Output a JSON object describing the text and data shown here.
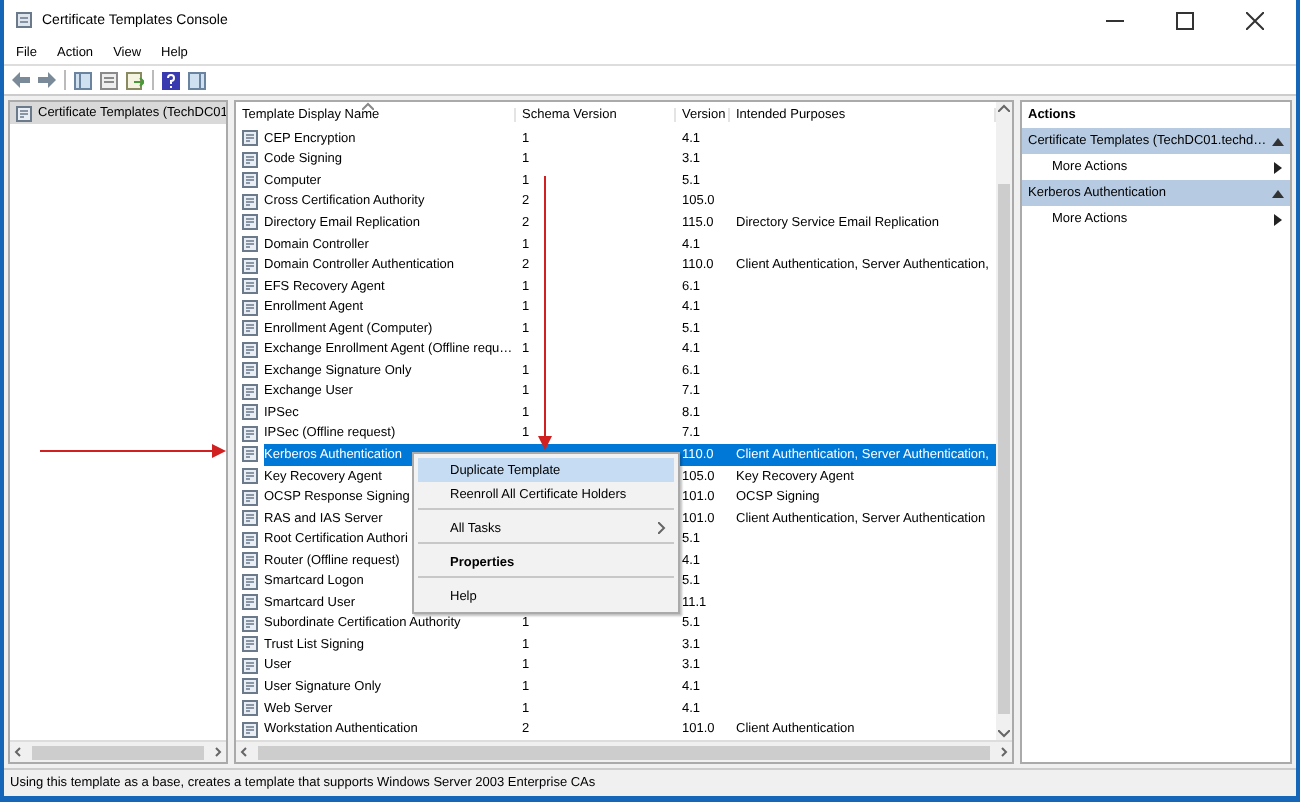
{
  "window": {
    "title": "Certificate Templates Console"
  },
  "menu_bar": [
    "File",
    "Action",
    "View",
    "Help"
  ],
  "tree": {
    "items": [
      {
        "label": "Certificate Templates (TechDC01",
        "selected": true
      }
    ]
  },
  "list": {
    "columns": [
      "Template Display Name",
      "Schema Version",
      "Version",
      "Intended Purposes"
    ],
    "rows": [
      {
        "name": "CEP Encryption",
        "schema": "1",
        "version": "4.1",
        "purposes": "",
        "selected": false
      },
      {
        "name": "Code Signing",
        "schema": "1",
        "version": "3.1",
        "purposes": "",
        "selected": false
      },
      {
        "name": "Computer",
        "schema": "1",
        "version": "5.1",
        "purposes": "",
        "selected": false
      },
      {
        "name": "Cross Certification Authority",
        "schema": "2",
        "version": "105.0",
        "purposes": "",
        "selected": false
      },
      {
        "name": "Directory Email Replication",
        "schema": "2",
        "version": "115.0",
        "purposes": "Directory Service Email Replication",
        "selected": false
      },
      {
        "name": "Domain Controller",
        "schema": "1",
        "version": "4.1",
        "purposes": "",
        "selected": false
      },
      {
        "name": "Domain Controller Authentication",
        "schema": "2",
        "version": "110.0",
        "purposes": "Client Authentication, Server Authentication,",
        "selected": false
      },
      {
        "name": "EFS Recovery Agent",
        "schema": "1",
        "version": "6.1",
        "purposes": "",
        "selected": false
      },
      {
        "name": "Enrollment Agent",
        "schema": "1",
        "version": "4.1",
        "purposes": "",
        "selected": false
      },
      {
        "name": "Enrollment Agent (Computer)",
        "schema": "1",
        "version": "5.1",
        "purposes": "",
        "selected": false
      },
      {
        "name": "Exchange Enrollment Agent (Offline requ…",
        "schema": "1",
        "version": "4.1",
        "purposes": "",
        "selected": false
      },
      {
        "name": "Exchange Signature Only",
        "schema": "1",
        "version": "6.1",
        "purposes": "",
        "selected": false
      },
      {
        "name": "Exchange User",
        "schema": "1",
        "version": "7.1",
        "purposes": "",
        "selected": false
      },
      {
        "name": "IPSec",
        "schema": "1",
        "version": "8.1",
        "purposes": "",
        "selected": false
      },
      {
        "name": "IPSec (Offline request)",
        "schema": "1",
        "version": "7.1",
        "purposes": "",
        "selected": false
      },
      {
        "name": "Kerberos Authentication",
        "schema": "",
        "version": "110.0",
        "purposes": "Client Authentication, Server Authentication,",
        "selected": true
      },
      {
        "name": "Key Recovery Agent",
        "schema": "",
        "version": "105.0",
        "purposes": "Key Recovery Agent",
        "selected": false
      },
      {
        "name": "OCSP Response Signing",
        "schema": "",
        "version": "101.0",
        "purposes": "OCSP Signing",
        "selected": false
      },
      {
        "name": "RAS and IAS Server",
        "schema": "",
        "version": "101.0",
        "purposes": "Client Authentication, Server Authentication",
        "selected": false
      },
      {
        "name": "Root Certification Authori",
        "schema": "",
        "version": "5.1",
        "purposes": "",
        "selected": false
      },
      {
        "name": "Router (Offline request)",
        "schema": "",
        "version": "4.1",
        "purposes": "",
        "selected": false
      },
      {
        "name": "Smartcard Logon",
        "schema": "",
        "version": "5.1",
        "purposes": "",
        "selected": false
      },
      {
        "name": "Smartcard User",
        "schema": "",
        "version": "11.1",
        "purposes": "",
        "selected": false
      },
      {
        "name": "Subordinate Certification Authority",
        "schema": "1",
        "version": "5.1",
        "purposes": "",
        "selected": false
      },
      {
        "name": "Trust List Signing",
        "schema": "1",
        "version": "3.1",
        "purposes": "",
        "selected": false
      },
      {
        "name": "User",
        "schema": "1",
        "version": "3.1",
        "purposes": "",
        "selected": false
      },
      {
        "name": "User Signature Only",
        "schema": "1",
        "version": "4.1",
        "purposes": "",
        "selected": false
      },
      {
        "name": "Web Server",
        "schema": "1",
        "version": "4.1",
        "purposes": "",
        "selected": false
      },
      {
        "name": "Workstation Authentication",
        "schema": "2",
        "version": "101.0",
        "purposes": "Client Authentication",
        "selected": false
      }
    ]
  },
  "actions": {
    "title": "Actions",
    "sections": [
      {
        "title": "Certificate Templates (TechDC01.techd…",
        "items": [
          "More Actions"
        ]
      },
      {
        "title": "Kerberos Authentication",
        "items": [
          "More Actions"
        ]
      }
    ]
  },
  "context_menu": {
    "items": [
      {
        "label": "Duplicate Template",
        "selected": true,
        "bold": false,
        "submenu": false,
        "separator_before": false
      },
      {
        "label": "Reenroll All Certificate Holders",
        "selected": false,
        "bold": false,
        "submenu": false,
        "separator_before": false
      },
      {
        "label": "All Tasks",
        "selected": false,
        "bold": false,
        "submenu": true,
        "separator_before": true
      },
      {
        "label": "Properties",
        "selected": false,
        "bold": true,
        "submenu": false,
        "separator_before": true
      },
      {
        "label": "Help",
        "selected": false,
        "bold": false,
        "submenu": false,
        "separator_before": true
      }
    ]
  },
  "status_bar": {
    "text": "Using this template as a base, creates a template that supports Windows Server 2003 Enterprise CAs"
  }
}
